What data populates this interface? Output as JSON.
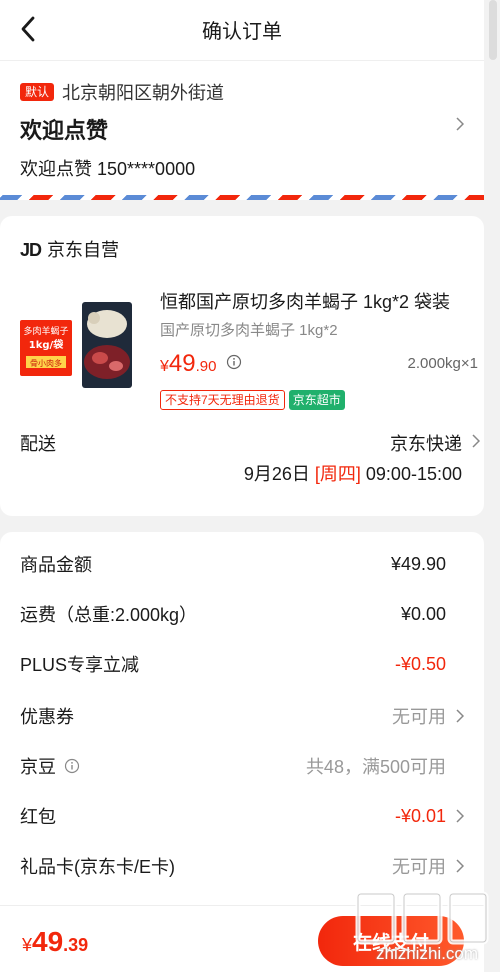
{
  "header": {
    "title": "确认订单",
    "back_icon": "chevron-left-icon"
  },
  "address": {
    "default_tag": "默认",
    "location": "北京朝阳区朝外街道",
    "name": "欢迎点赞",
    "contact": "欢迎点赞 150****0000"
  },
  "shop": {
    "logo": "JD",
    "name": "京东自营",
    "product": {
      "title": "恒都国产原切多肉羊蝎子 1kg*2 袋装",
      "spec": "国产原切多肉羊蝎子 1kg*2",
      "price_currency": "¥",
      "price_int": "49",
      "price_dec": ".90",
      "quantity": "2.000kg×1",
      "tag_no_return": "不支持7天无理由退货",
      "tag_market": "京东超市",
      "image_label_1": "多肉羊蝎子",
      "image_label_2": "1kg/袋",
      "image_label_3": "骨小肉多"
    },
    "delivery": {
      "label": "配送",
      "method": "京东快递",
      "date": "9月26日",
      "weekday": "[周四]",
      "time": "09:00-15:00"
    }
  },
  "fees": {
    "items": [
      {
        "label": "商品金额",
        "value": "¥49.90"
      },
      {
        "label": "运费（总重:2.000kg）",
        "value": "¥0.00"
      },
      {
        "label": "PLUS专享立减",
        "value": "-¥0.50"
      },
      {
        "label": "优惠券",
        "value": "无可用"
      },
      {
        "label": "京豆",
        "value": "共48，满500可用"
      },
      {
        "label": "红包",
        "value": "-¥0.01"
      },
      {
        "label": "礼品卡(京东卡/E卡)",
        "value": "无可用"
      }
    ]
  },
  "footer": {
    "currency": "¥",
    "total_int": "49",
    "total_dec": ".39",
    "pay_label": "在线支付"
  },
  "watermark": {
    "text": "zhizhizhi.com",
    "glyphs": "值值值"
  },
  "colors": {
    "accent": "#f2270c",
    "green": "#20b06c",
    "stripe_blue": "#5b8bd6"
  }
}
